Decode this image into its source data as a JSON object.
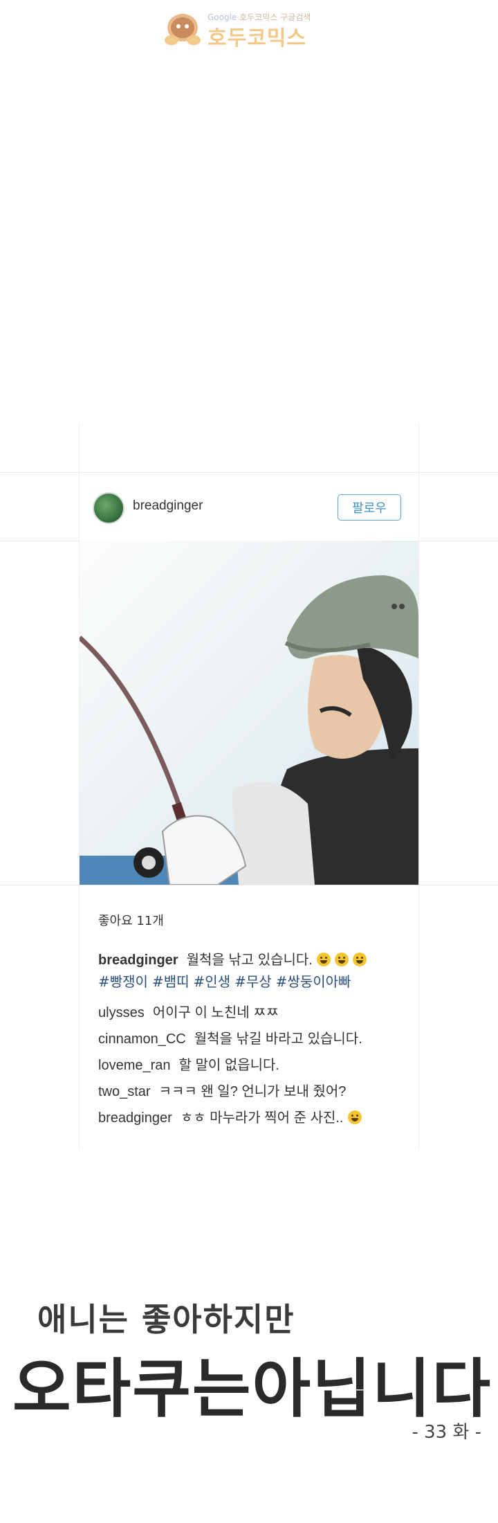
{
  "watermark": {
    "small_text_google": "Google",
    "small_text": "호두코믹스",
    "small_text_search": "구글검색",
    "big_text": "호두코믹스",
    "mascot_icon": "walnut-mascot-icon"
  },
  "post": {
    "username": "breadginger",
    "follow_label": "팔로우",
    "likes": "좋아요 11개",
    "caption_user": "breadginger",
    "caption_text": "월척을 낚고 있습니다.",
    "hashtags": [
      "#빵쟁이",
      "#뱀띠",
      "#인생",
      "#무상",
      "#쌍둥이아빠"
    ],
    "comments": [
      {
        "user": "ulysses",
        "text": "어이구 이 노친네 ㅉㅉ"
      },
      {
        "user": "cinnamon_CC",
        "text": "월척을 낚길 바라고 있습니다."
      },
      {
        "user": "loveme_ran",
        "text": "할 말이 없읍니다."
      },
      {
        "user": "two_star",
        "text": "ㅋㅋㅋ 왠 일? 언니가 보내 줬어?"
      },
      {
        "user": "breadginger",
        "text": "ㅎㅎ 마누라가 찍어 준 사진.."
      }
    ]
  },
  "title": {
    "line1": "애니는 좋아하지만",
    "line2": "오타쿠는아닙니다",
    "episode": "- 33 화 -"
  },
  "colors": {
    "follow_accent": "#5aa6d6",
    "hashtag": "#2b4f7a",
    "emoji": "#f4c531"
  }
}
